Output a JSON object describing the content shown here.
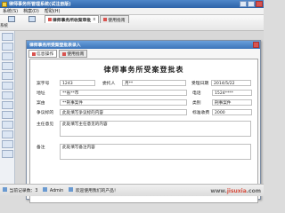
{
  "window": {
    "title": "律师事务所管理系统(试注册版)"
  },
  "menubar": {
    "items": [
      "系统(S)",
      "档案(D)",
      "帮助(H)"
    ]
  },
  "toolbar": {
    "buttons": [
      {
        "label": "系统"
      },
      {
        "label": ""
      }
    ]
  },
  "document_tabs": [
    {
      "label": "律师事务所收案审批",
      "active": true,
      "close": "x"
    },
    {
      "label": "使用指南",
      "active": false
    }
  ],
  "dialog": {
    "title": "律师事务所受案登批表录入",
    "tabs": [
      {
        "label": "信息操作",
        "active": true
      },
      {
        "label": "使用指南",
        "active": false
      }
    ],
    "form_title": "律师事务所受案登批表",
    "fields": {
      "case_no_label": "案字号",
      "case_no_value": "1243",
      "entrust_label": "委托人",
      "entrust_value": "月**",
      "accept_time_label": "受理日期",
      "accept_time_value": "2014/5/22",
      "address_label": "地址",
      "address_value": "**省**市",
      "phone_label": "电话",
      "phone_value": "1524****",
      "cause_label": "案由",
      "cause_value": "**刑事案件",
      "type_label": "类别",
      "type_value": "刑事案件",
      "brief_label": "争议标的",
      "brief_value": "此处填写争议标的内容",
      "fee_label": "标准收费",
      "fee_value": "2000",
      "opinion_label": "主任意见",
      "opinion_value": "此处填写主任意见的内容",
      "remark_label": "备注",
      "remark_value": "此处填写备注内容"
    }
  },
  "taskbar": {
    "items": [
      "当前记录数：3",
      "Admin",
      "欢迎使用我们的产品！"
    ],
    "watermark_prefix": "www.",
    "watermark_brand": "jisuxia",
    "watermark_suffix": ".com"
  },
  "colors": {
    "title_bar": "#2d63a8",
    "tab_accent": "#d9534f"
  }
}
